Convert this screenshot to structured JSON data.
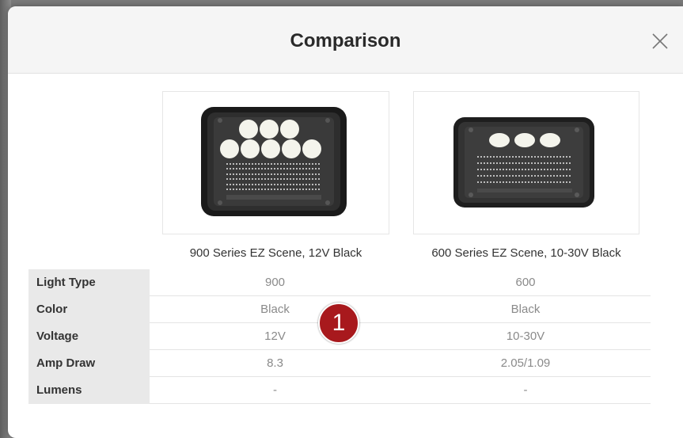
{
  "modal": {
    "title": "Comparison",
    "close_icon": "close-icon"
  },
  "products": [
    {
      "name": "900 Series EZ Scene, 12V Black",
      "image": "light-bar-900-image"
    },
    {
      "name": "600 Series EZ Scene, 10-30V Black",
      "image": "light-bar-600-image"
    }
  ],
  "specs": [
    {
      "label": "Light Type",
      "values": [
        "900",
        "600"
      ]
    },
    {
      "label": "Color",
      "values": [
        "Black",
        "Black"
      ]
    },
    {
      "label": "Voltage",
      "values": [
        "12V",
        "10-30V"
      ]
    },
    {
      "label": "Amp Draw",
      "values": [
        "8.3",
        "2.05/1.09"
      ]
    },
    {
      "label": "Lumens",
      "values": [
        "-",
        "-"
      ]
    }
  ],
  "annotation": {
    "number": "1",
    "color": "#a8191d"
  }
}
